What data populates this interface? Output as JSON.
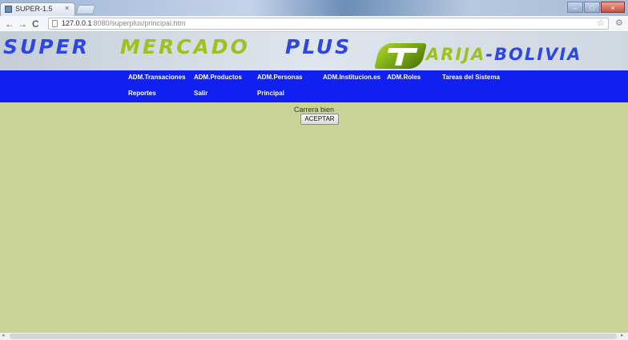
{
  "browser": {
    "tab_title": "SUPER-1.5",
    "tab_close_glyph": "×",
    "url_host": "127.0.0.1",
    "url_path": ":8080/superplus/principal.htm",
    "back_glyph": "←",
    "forward_glyph": "→",
    "reload_glyph": "C",
    "star_glyph": "☆",
    "wrench_glyph": "⚙",
    "minimize_glyph": "–",
    "maximize_glyph": "□",
    "close_glyph": "×"
  },
  "header": {
    "word_super": "SUPER",
    "word_mercado": "MERCADO",
    "word_plus": "PLUS",
    "word_arija": "ARIJA",
    "word_bolivia": "-BOLIVIA"
  },
  "menu": {
    "row1": [
      "ADM.Transaciones",
      "ADM.Productos",
      "ADM.Personas",
      "ADM.Institucion.es",
      "ADM.Roles",
      "Tareas del Sistema"
    ],
    "row2": [
      "Reportes",
      "Salir",
      "Principal"
    ]
  },
  "content": {
    "message": "Carrera bien",
    "accept_label": "ACEPTAR"
  },
  "scrollbar": {
    "left_arrow": "◂",
    "right_arrow": "▸"
  },
  "colors": {
    "menu_bar": "#1020f0",
    "page_background": "#c9d396",
    "brand_blue": "#2d47e6",
    "brand_green": "#9ec21a"
  }
}
